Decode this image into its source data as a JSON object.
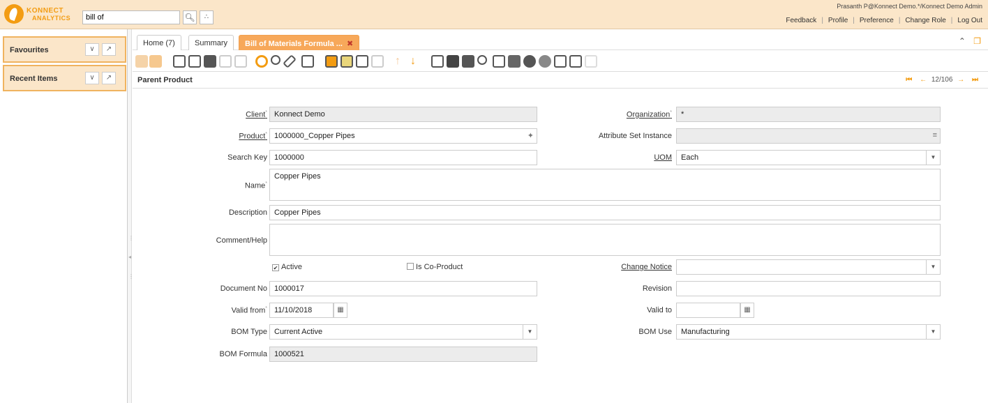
{
  "header": {
    "logo_line1": "KONNECT",
    "logo_line2": "ANALYTICS",
    "search_value": "bill of",
    "user_info": "Prasanth P@Konnect Demo.*/Konnect Demo Admin",
    "links": [
      "Feedback",
      "Profile",
      "Preference",
      "Change Role",
      "Log Out"
    ]
  },
  "left_panel": {
    "favourites": "Favourites",
    "recent_items": "Recent Items"
  },
  "tabs": [
    {
      "label": "Home (7)"
    },
    {
      "label": "Summary"
    },
    {
      "label": "Bill of Materials Formula ..."
    }
  ],
  "title": "Parent Product",
  "record_nav": "12/106",
  "form": {
    "client_label": "Client",
    "client_value": "Konnect Demo",
    "org_label": "Organization",
    "org_value": "*",
    "product_label": "Product",
    "product_value": "1000000_Copper Pipes",
    "asi_label": "Attribute Set Instance",
    "asi_value": "",
    "search_key_label": "Search Key",
    "search_key_value": "1000000",
    "uom_label": "UOM",
    "uom_value": "Each",
    "name_label": "Name",
    "name_value": "Copper Pipes",
    "description_label": "Description",
    "description_value": "Copper Pipes",
    "comment_label": "Comment/Help",
    "comment_value": "",
    "active_label": "Active",
    "active_checked": true,
    "coproduct_label": "Is Co-Product",
    "coproduct_checked": false,
    "change_notice_label": "Change Notice",
    "change_notice_value": "",
    "docno_label": "Document No",
    "docno_value": "1000017",
    "revision_label": "Revision",
    "revision_value": "",
    "valid_from_label": "Valid from",
    "valid_from_value": "11/10/2018",
    "valid_to_label": "Valid to",
    "valid_to_value": "",
    "bom_type_label": "BOM Type",
    "bom_type_value": "Current Active",
    "bom_use_label": "BOM Use",
    "bom_use_value": "Manufacturing",
    "bom_formula_label": "BOM Formula",
    "bom_formula_value": "1000521"
  },
  "colors": {
    "accent": "#f39c12",
    "header_bg": "#fbe6c9",
    "active_tab": "#f7a85a"
  }
}
